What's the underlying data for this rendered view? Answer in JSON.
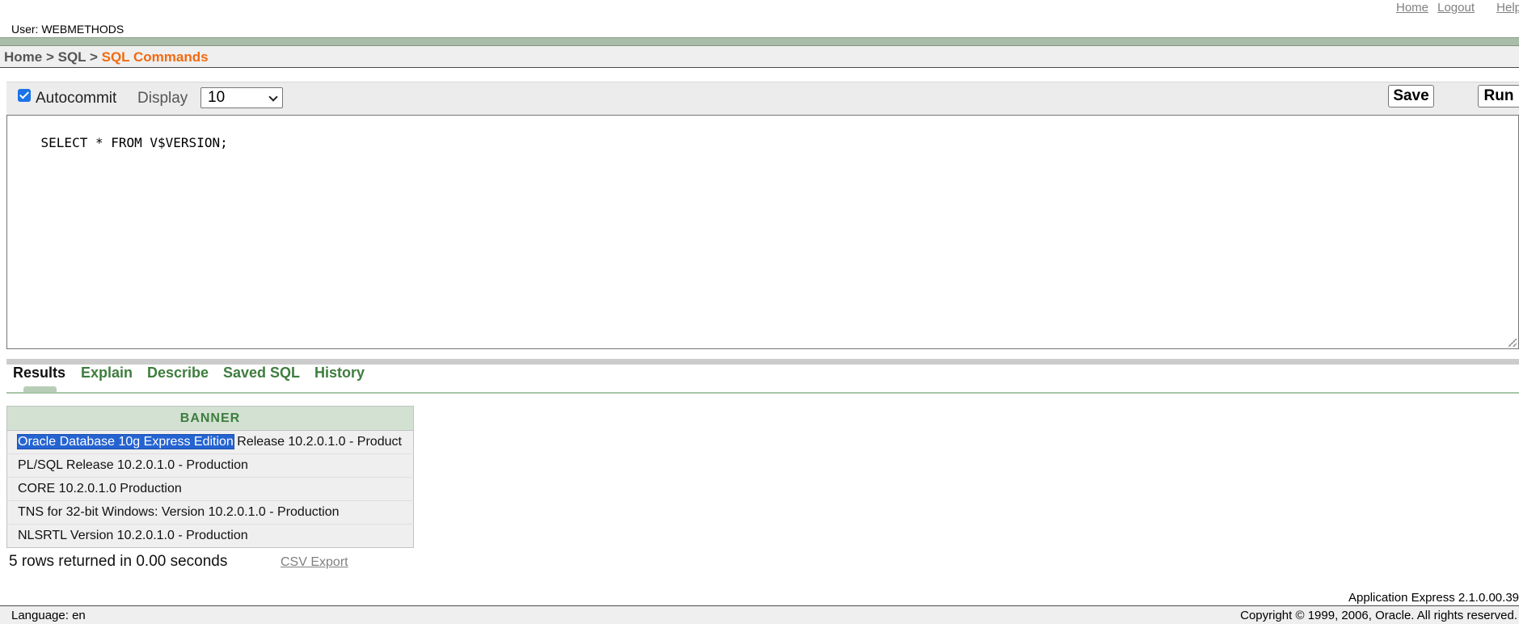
{
  "header": {
    "links": [
      "Home",
      "Logout",
      "Help"
    ],
    "user_label": "User: WEBMETHODS"
  },
  "breadcrumb": {
    "items": [
      "Home",
      "SQL"
    ],
    "separator": " > ",
    "current": "SQL Commands"
  },
  "editor": {
    "autocommit_label": "Autocommit",
    "autocommit_checked": true,
    "display_label": "Display",
    "display_value": "10",
    "save_label": "Save",
    "run_label": "Run",
    "sql_text": "SELECT * FROM V$VERSION;"
  },
  "tabs": [
    {
      "label": "Results",
      "active": true
    },
    {
      "label": "Explain",
      "active": false
    },
    {
      "label": "Describe",
      "active": false
    },
    {
      "label": "Saved SQL",
      "active": false
    },
    {
      "label": "History",
      "active": false
    }
  ],
  "results": {
    "column_header": "BANNER",
    "rows": [
      {
        "selected_part": "Oracle Database 10g Express Edition",
        "rest": " Release 10.2.0.1.0 - Product"
      },
      {
        "selected_part": "",
        "rest": "PL/SQL Release 10.2.0.1.0 - Production"
      },
      {
        "selected_part": "",
        "rest": "CORE 10.2.0.1.0 Production"
      },
      {
        "selected_part": "",
        "rest": "TNS for 32-bit Windows: Version 10.2.0.1.0 - Production"
      },
      {
        "selected_part": "",
        "rest": "NLSRTL Version 10.2.0.1.0 - Production"
      }
    ],
    "status": "5 rows returned in 0.00 seconds",
    "csv_export_label": "CSV Export"
  },
  "footer": {
    "version": "Application Express 2.1.0.00.39",
    "language": "Language: en",
    "copyright": "Copyright © 1999, 2006, Oracle. All rights reserved."
  },
  "colors": {
    "accent_orange": "#f26a10",
    "tab_green": "#3e7d3e",
    "band_green": "#a9bda9",
    "selection_blue": "#2563d1"
  }
}
